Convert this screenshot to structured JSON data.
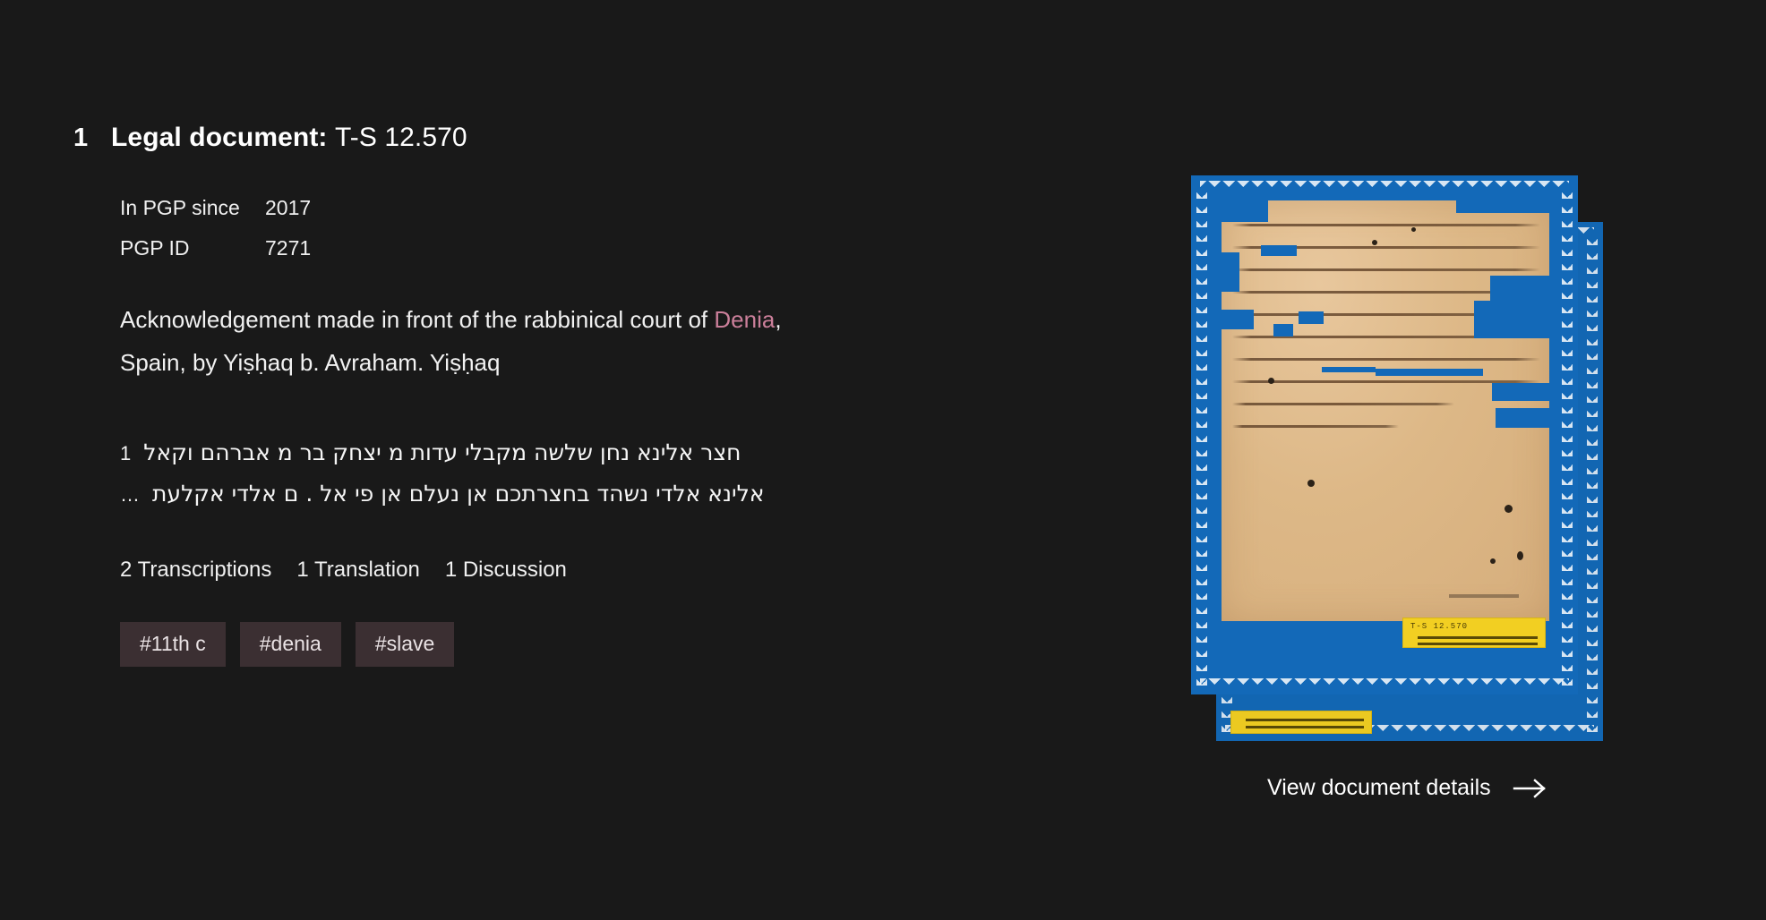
{
  "background_color": "#191919",
  "accent_color": "#cb7f9a",
  "tag_background_color": "#3b2f32",
  "result": {
    "number": "1",
    "doc_type": "Legal document:",
    "shelfmark": "T-S 12.570",
    "metadata": [
      {
        "label": "In PGP since",
        "value": "2017"
      },
      {
        "label": "PGP ID",
        "value": "7271"
      }
    ],
    "description": {
      "before_link": "Acknowledgement made in front of the rabbinical court of ",
      "link_text": "Denia",
      "after_link": ", Spain, by Yiṣḥaq b. Avraham. Yiṣḥaq"
    },
    "transcription": [
      {
        "line_number": "1",
        "text": "חצר אלינא נחן שלשה מקבלי עדות מ יצחק בר מ אברהם וקאל"
      },
      {
        "line_number": "…",
        "text": "אלינא אלדי נשהד בחצרתכם אן נעלם אן פי אל . ם אלדי אקלעת"
      }
    ],
    "counts": [
      "2 Transcriptions",
      "1 Translation",
      "1 Discussion"
    ],
    "tags": [
      "#11th c",
      "#denia",
      "#slave"
    ],
    "images": {
      "front": {
        "alt": "manuscript-fragment-recto",
        "mount_color": "#1369b8",
        "parchment_color": "#ddb887",
        "label_text": "T-S  12.570",
        "label_color": "#f2cf22"
      },
      "back": {
        "alt": "manuscript-fragment-verso",
        "mount_color": "#1369b8",
        "parchment_color": "#ddb887",
        "label_color": "#f2cf22"
      }
    },
    "details_link": {
      "label": "View document details",
      "icon": "arrow-right-icon"
    }
  }
}
